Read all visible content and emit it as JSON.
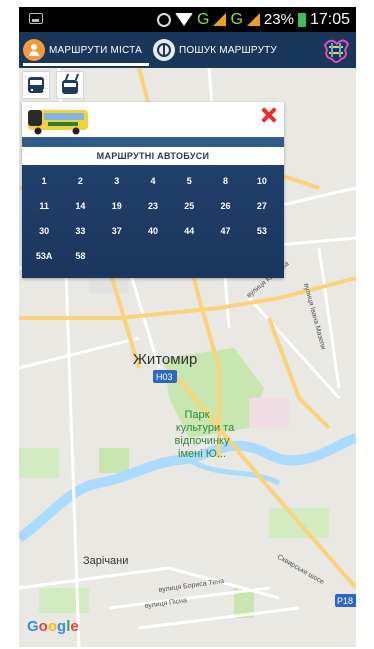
{
  "status_bar": {
    "network": "G",
    "network2": "G",
    "battery": "23%",
    "time": "17:05"
  },
  "header": {
    "tab_routes": "МАРШРУТИ МІСТА",
    "tab_search": "ПОШУК МАРШРУТУ"
  },
  "panel": {
    "title": "МАРШРУТНІ АВТОБУСИ",
    "routes": [
      "1",
      "2",
      "3",
      "4",
      "5",
      "8",
      "10",
      "11",
      "14",
      "19",
      "23",
      "25",
      "26",
      "27",
      "30",
      "33",
      "37",
      "40",
      "44",
      "47",
      "53",
      "53А",
      "58"
    ]
  },
  "map": {
    "city": "Житомир",
    "shield_h03": "Н03",
    "shield_p18": "Р18",
    "park": "Парк культури та відпочинку імені Ю...",
    "zarichany": "Зарічани",
    "street_kyivska": "вулиця Київська",
    "street_skvyrske": "Сквирське шосе",
    "street_tena": "вулиця Бориса Тена",
    "street_pisna": "вулиця Пісна",
    "street_maiora": "вулиця Івана Мазепи",
    "google": "Google"
  },
  "colors": {
    "header_bg": "#19375a",
    "panel_bg": "#1e3a5f",
    "close": "#e8322f",
    "water": "#aadaff",
    "park": "#c0e5a8",
    "road": "#fad37a"
  }
}
